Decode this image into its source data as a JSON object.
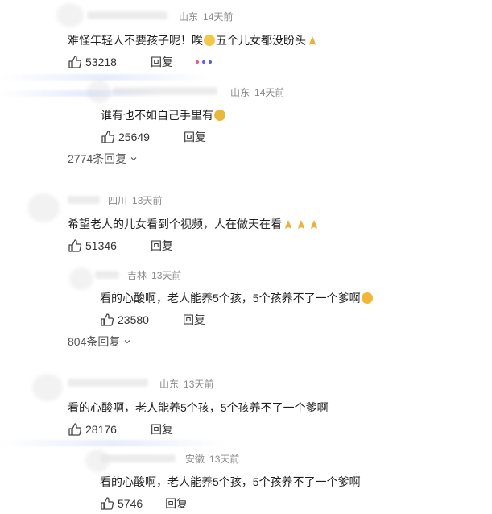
{
  "comments": [
    {
      "location": "山东",
      "time": "14天前",
      "text_before": "难怪年轻人不要孩子呢！唉",
      "text_after": "五个儿女都没盼头",
      "likes": "53218",
      "reply": "回复",
      "emojis": [
        "tired-face-icon",
        "praying-hands-icon"
      ],
      "sub": {
        "location": "山东",
        "time": "14天前",
        "text": "谁有也不如自己手里有",
        "emoji": "money-mouth-icon",
        "likes": "25649",
        "reply": "回复"
      },
      "expand": "2774条回复"
    },
    {
      "location": "四川",
      "time": "13天前",
      "text": "希望老人的儿女看到个视频，人在做天在看",
      "emojis": [
        "praying-hands-icon",
        "praying-hands-icon",
        "praying-hands-icon"
      ],
      "likes": "51346",
      "reply": "回复",
      "sub": {
        "location": "吉林",
        "time": "13天前",
        "text": "看的心酸啊，老人能养5个孩，5个孩养不了一个爹啊",
        "emoji": "crying-face-icon",
        "likes": "23580",
        "reply": "回复"
      },
      "expand": "804条回复"
    },
    {
      "location": "山东",
      "time": "13天前",
      "text": "看的心酸啊，老人能养5个孩，5个孩养不了一个爹啊",
      "likes": "28176",
      "reply": "回复",
      "sub": {
        "location": "安徽",
        "time": "13天前",
        "text": "看的心酸啊，老人能养5个孩，5个孩养不了一个爹啊",
        "likes": "5746",
        "reply": "回复"
      }
    }
  ],
  "colors": {
    "text": "#1f1f1f",
    "meta": "#8a8a8a",
    "action": "#333333",
    "background": "#ffffff"
  }
}
